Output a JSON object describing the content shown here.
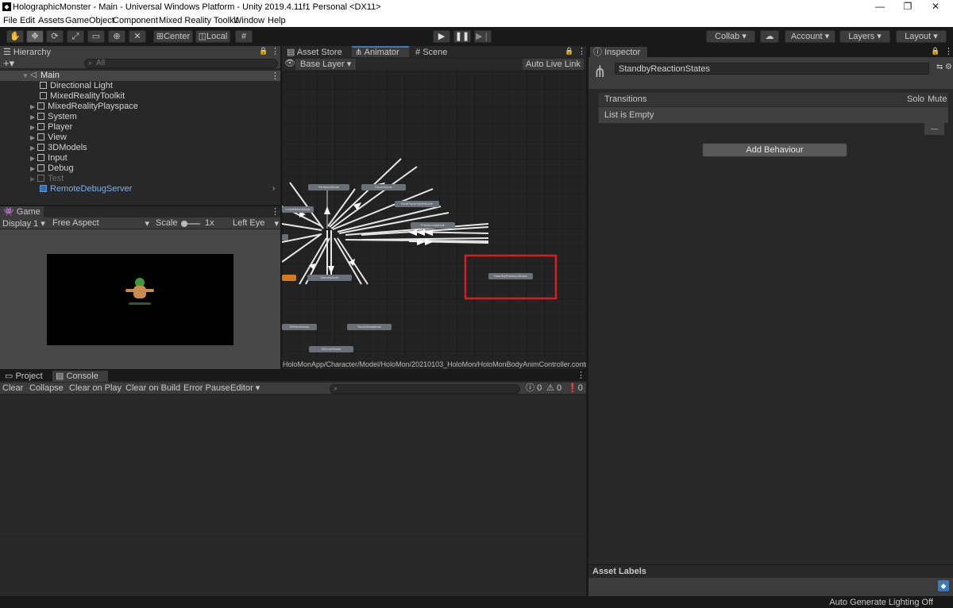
{
  "window": {
    "title": "HolographicMonster - Main - Universal Windows Platform - Unity 2019.4.11f1 Personal <DX11>",
    "minimize": "—",
    "restore": "❐",
    "close": "✕"
  },
  "menu": [
    "File",
    "Edit",
    "Assets",
    "GameObject",
    "Component",
    "Mixed Reality Toolkit",
    "Window",
    "Help"
  ],
  "toolbar": {
    "center": "Center",
    "local": "Local",
    "collab": "Collab",
    "account": "Account",
    "layers": "Layers",
    "layout": "Layout"
  },
  "hierarchy": {
    "tab": "Hierarchy",
    "search_placeholder": "All",
    "root": "Main",
    "items": [
      {
        "label": "Directional Light"
      },
      {
        "label": "MixedRealityToolkit"
      },
      {
        "label": "MixedRealityPlayspace"
      },
      {
        "label": "System"
      },
      {
        "label": "Player"
      },
      {
        "label": "View"
      },
      {
        "label": "3DModels"
      },
      {
        "label": "Input"
      },
      {
        "label": "Debug"
      },
      {
        "label": "Test"
      },
      {
        "label": "RemoteDebugServer"
      }
    ]
  },
  "game": {
    "tab": "Game",
    "display": "Display 1",
    "aspect": "Free Aspect",
    "scale_label": "Scale",
    "scale_value": "1x",
    "eye": "Left Eye"
  },
  "center_tabs": {
    "asset_store": "Asset Store",
    "animator": "Animator",
    "scene": "Scene"
  },
  "animator": {
    "layer": "Base Layer",
    "auto_live_link": "Auto Live Link",
    "path": "HoloMonApp/Character/Model/HoloMon/20210103_HoloMon/HoloMonBodyAnimController.controlle",
    "nodes": {
      "reaction": "ReactionMode",
      "dance": "DanceMode",
      "rest": "RestPlaceHolderMode",
      "friend": "FriendLookMode",
      "look": "LookAtMomMode",
      "standby": "StandbyMain",
      "standby_reaction": "StandbyReactionStates",
      "sit": "SitRelaxMode",
      "touch": "TouchHeadMode",
      "sleep": "SitDownMode"
    }
  },
  "console": {
    "project_tab": "Project",
    "console_tab": "Console",
    "buttons": [
      "Clear",
      "Collapse",
      "Clear on Play",
      "Clear on Build",
      "Error Pause",
      "Editor"
    ],
    "counts": {
      "log": "0",
      "warn": "0",
      "error": "0"
    }
  },
  "inspector": {
    "tab": "Inspector",
    "name": "StandbyReactionStates",
    "transitions": "Transitions",
    "solo": "Solo",
    "mute": "Mute",
    "empty": "List is Empty",
    "minus": "—",
    "add_behaviour": "Add Behaviour",
    "asset_labels": "Asset Labels"
  },
  "status": {
    "lighting": "Auto Generate Lighting Off"
  },
  "colors": {
    "accent": "#3a79bb",
    "highlight_box": "#d81e1e",
    "node_orange": "#d27a1e"
  }
}
